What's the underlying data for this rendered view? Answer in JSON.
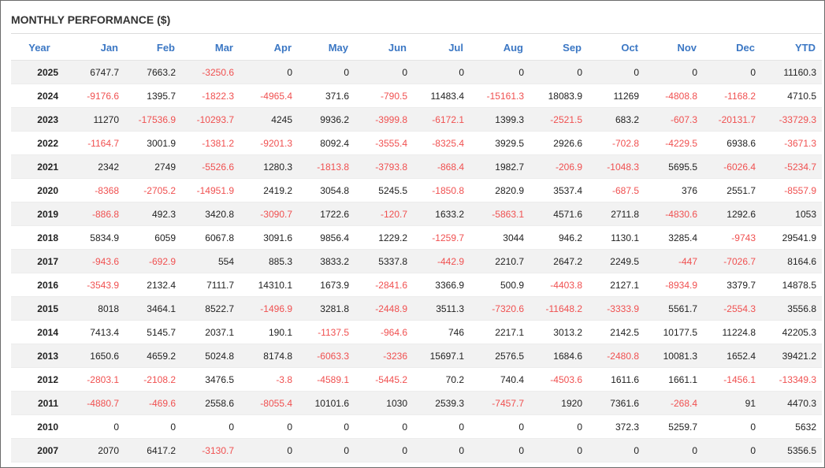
{
  "chart_data": {
    "type": "table",
    "title": "MONTHLY PERFORMANCE ($)",
    "columns": [
      "Year",
      "Jan",
      "Feb",
      "Mar",
      "Apr",
      "May",
      "Jun",
      "Jul",
      "Aug",
      "Sep",
      "Oct",
      "Nov",
      "Dec",
      "YTD"
    ],
    "rows": [
      [
        "2025",
        "6747.7",
        "7663.2",
        "-3250.6",
        "0",
        "0",
        "0",
        "0",
        "0",
        "0",
        "0",
        "0",
        "0",
        "11160.3"
      ],
      [
        "2024",
        "-9176.6",
        "1395.7",
        "-1822.3",
        "-4965.4",
        "371.6",
        "-790.5",
        "11483.4",
        "-15161.3",
        "18083.9",
        "11269",
        "-4808.8",
        "-1168.2",
        "4710.5"
      ],
      [
        "2023",
        "11270",
        "-17536.9",
        "-10293.7",
        "4245",
        "9936.2",
        "-3999.8",
        "-6172.1",
        "1399.3",
        "-2521.5",
        "683.2",
        "-607.3",
        "-20131.7",
        "-33729.3"
      ],
      [
        "2022",
        "-1164.7",
        "3001.9",
        "-1381.2",
        "-9201.3",
        "8092.4",
        "-3555.4",
        "-8325.4",
        "3929.5",
        "2926.6",
        "-702.8",
        "-4229.5",
        "6938.6",
        "-3671.3"
      ],
      [
        "2021",
        "2342",
        "2749",
        "-5526.6",
        "1280.3",
        "-1813.8",
        "-3793.8",
        "-868.4",
        "1982.7",
        "-206.9",
        "-1048.3",
        "5695.5",
        "-6026.4",
        "-5234.7"
      ],
      [
        "2020",
        "-8368",
        "-2705.2",
        "-14951.9",
        "2419.2",
        "3054.8",
        "5245.5",
        "-1850.8",
        "2820.9",
        "3537.4",
        "-687.5",
        "376",
        "2551.7",
        "-8557.9"
      ],
      [
        "2019",
        "-886.8",
        "492.3",
        "3420.8",
        "-3090.7",
        "1722.6",
        "-120.7",
        "1633.2",
        "-5863.1",
        "4571.6",
        "2711.8",
        "-4830.6",
        "1292.6",
        "1053"
      ],
      [
        "2018",
        "5834.9",
        "6059",
        "6067.8",
        "3091.6",
        "9856.4",
        "1229.2",
        "-1259.7",
        "3044",
        "946.2",
        "1130.1",
        "3285.4",
        "-9743",
        "29541.9"
      ],
      [
        "2017",
        "-943.6",
        "-692.9",
        "554",
        "885.3",
        "3833.2",
        "5337.8",
        "-442.9",
        "2210.7",
        "2647.2",
        "2249.5",
        "-447",
        "-7026.7",
        "8164.6"
      ],
      [
        "2016",
        "-3543.9",
        "2132.4",
        "7111.7",
        "14310.1",
        "1673.9",
        "-2841.6",
        "3366.9",
        "500.9",
        "-4403.8",
        "2127.1",
        "-8934.9",
        "3379.7",
        "14878.5"
      ],
      [
        "2015",
        "8018",
        "3464.1",
        "8522.7",
        "-1496.9",
        "3281.8",
        "-2448.9",
        "3511.3",
        "-7320.6",
        "-11648.2",
        "-3333.9",
        "5561.7",
        "-2554.3",
        "3556.8"
      ],
      [
        "2014",
        "7413.4",
        "5145.7",
        "2037.1",
        "190.1",
        "-1137.5",
        "-964.6",
        "746",
        "2217.1",
        "3013.2",
        "2142.5",
        "10177.5",
        "11224.8",
        "42205.3"
      ],
      [
        "2013",
        "1650.6",
        "4659.2",
        "5024.8",
        "8174.8",
        "-6063.3",
        "-3236",
        "15697.1",
        "2576.5",
        "1684.6",
        "-2480.8",
        "10081.3",
        "1652.4",
        "39421.2"
      ],
      [
        "2012",
        "-2803.1",
        "-2108.2",
        "3476.5",
        "-3.8",
        "-4589.1",
        "-5445.2",
        "70.2",
        "740.4",
        "-4503.6",
        "1611.6",
        "1661.1",
        "-1456.1",
        "-13349.3"
      ],
      [
        "2011",
        "-4880.7",
        "-469.6",
        "2558.6",
        "-8055.4",
        "10101.6",
        "1030",
        "2539.3",
        "-7457.7",
        "1920",
        "7361.6",
        "-268.4",
        "91",
        "4470.3"
      ],
      [
        "2010",
        "0",
        "0",
        "0",
        "0",
        "0",
        "0",
        "0",
        "0",
        "0",
        "372.3",
        "5259.7",
        "0",
        "5632"
      ],
      [
        "2007",
        "2070",
        "6417.2",
        "-3130.7",
        "0",
        "0",
        "0",
        "0",
        "0",
        "0",
        "0",
        "0",
        "0",
        "5356.5"
      ]
    ]
  },
  "colors": {
    "header_text": "#3b77c4",
    "negative_text": "#f05050",
    "positive_text": "#222222",
    "stripe_background": "#f2f2f2",
    "border": "#6b6b6b"
  }
}
